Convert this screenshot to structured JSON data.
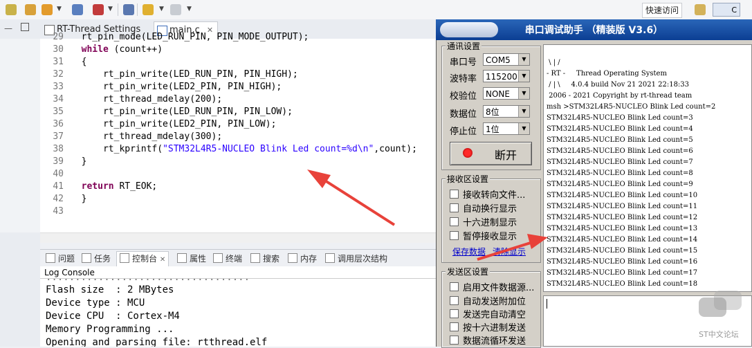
{
  "toolbar": {
    "quick_access": "快速访问"
  },
  "editor": {
    "tabs": [
      {
        "label": "RT-Thread Settings"
      },
      {
        "label": "main.c",
        "close": "✕"
      }
    ],
    "lines": [
      {
        "n": "29",
        "code": "rt_pin_mode(LED_RUN_PIN, PIN_MODE_OUTPUT);"
      },
      {
        "n": "30",
        "kw": "while",
        "code": " (count++)"
      },
      {
        "n": "31",
        "code": "{"
      },
      {
        "n": "32",
        "code": "    rt_pin_write(LED_RUN_PIN, PIN_HIGH);"
      },
      {
        "n": "33",
        "code": "    rt_pin_write(LED2_PIN, PIN_HIGH);"
      },
      {
        "n": "34",
        "code": "    rt_thread_mdelay(200);"
      },
      {
        "n": "35",
        "code": "    rt_pin_write(LED_RUN_PIN, PIN_LOW);"
      },
      {
        "n": "36",
        "code": "    rt_pin_write(LED2_PIN, PIN_LOW);"
      },
      {
        "n": "37",
        "code": "    rt_thread_mdelay(300);"
      },
      {
        "n": "38",
        "pre": "    rt_kprintf(",
        "str": "\"STM32L4R5-NUCLEO Blink Led count=%d\\n\"",
        "post": ",count);"
      },
      {
        "n": "39",
        "code": "}"
      },
      {
        "n": "40",
        "code": ""
      },
      {
        "n": "41",
        "kw": "return",
        "code": " RT_EOK;"
      },
      {
        "n": "42",
        "code": "}"
      },
      {
        "n": "43",
        "code": ""
      }
    ]
  },
  "bottom": {
    "tabs": [
      "问题",
      "任务",
      "控制台",
      "属性",
      "终端",
      "搜索",
      "内存",
      "调用层次结构"
    ],
    "console_title": "Log Console",
    "console_lines": [
      "Flash size  : 2 MBytes",
      "Device type : MCU",
      "Device CPU  : Cortex-M4",
      "Memory Programming ...",
      "Opening and parsing file: rtthread.elf"
    ]
  },
  "serial": {
    "title": "串口调试助手 （精装版 V3.6）",
    "comm_settings": "通讯设置",
    "port_label": "串口号",
    "port_value": "COM5",
    "baud_label": "波特率",
    "baud_value": "115200",
    "parity_label": "校验位",
    "parity_value": "NONE",
    "data_label": "数据位",
    "data_value": "8位",
    "stop_label": "停止位",
    "stop_value": "1位",
    "disconnect": "断开",
    "recv_settings": "接收区设置",
    "recv_options": [
      "接收转向文件...",
      "自动换行显示",
      "十六进制显示",
      "暂停接收显示"
    ],
    "save_data": "保存数据",
    "clear_display": "清除显示",
    "send_settings": "发送区设置",
    "send_options": [
      "启用文件数据源...",
      "自动发送附加位",
      "发送完自动清空",
      "按十六进制发送",
      "数据流循环发送"
    ],
    "recv_lines": [
      " \\ | /",
      "- RT -     Thread Operating System",
      " / | \\     4.0.4 build Nov 21 2021 22:18:33",
      " 2006 - 2021 Copyright by rt-thread team",
      "msh >STM32L4R5-NUCLEO Blink Led count=2",
      "STM32L4R5-NUCLEO Blink Led count=3",
      "STM32L4R5-NUCLEO Blink Led count=4",
      "STM32L4R5-NUCLEO Blink Led count=5",
      "STM32L4R5-NUCLEO Blink Led count=6",
      "STM32L4R5-NUCLEO Blink Led count=7",
      "STM32L4R5-NUCLEO Blink Led count=8",
      "STM32L4R5-NUCLEO Blink Led count=9",
      "STM32L4R5-NUCLEO Blink Led count=10",
      "STM32L4R5-NUCLEO Blink Led count=11",
      "STM32L4R5-NUCLEO Blink Led count=12",
      "STM32L4R5-NUCLEO Blink Led count=13",
      "STM32L4R5-NUCLEO Blink Led count=14",
      "STM32L4R5-NUCLEO Blink Led count=15",
      "STM32L4R5-NUCLEO Blink Led count=16",
      "STM32L4R5-NUCLEO Blink Led count=17",
      "STM32L4R5-NUCLEO Blink Led count=18"
    ]
  },
  "watermark": "ST中文论坛",
  "colors": {
    "arrow": "#e8423a",
    "title_bar": "#0b3e93",
    "keyword": "#7f0055",
    "string": "#2a00ff"
  }
}
